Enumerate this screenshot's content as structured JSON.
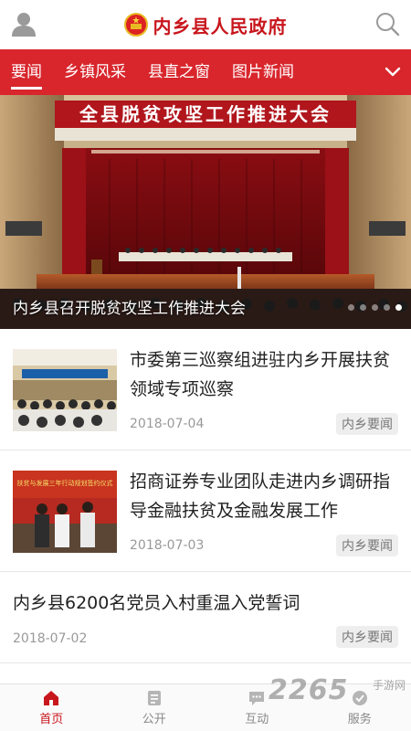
{
  "header": {
    "title": "内乡县人民政府",
    "avatar_icon": "user-icon",
    "emblem_icon": "national-emblem-icon",
    "search_icon": "search-icon"
  },
  "tabs": [
    {
      "label": "要闻",
      "active": true
    },
    {
      "label": "乡镇风采",
      "active": false
    },
    {
      "label": "县直之窗",
      "active": false
    },
    {
      "label": "图片新闻",
      "active": false
    }
  ],
  "hero": {
    "banner_text": "全县脱贫攻坚工作推进大会",
    "caption": "内乡县召开脱贫攻坚工作推进大会"
  },
  "news": [
    {
      "title": "市委第三巡察组进驻内乡开展扶贫领域专项巡察",
      "date": "2018-07-04",
      "tag": "内乡要闻"
    },
    {
      "title": "招商证券专业团队走进内乡调研指导金融扶贫及金融发展工作",
      "date": "2018-07-03",
      "tag": "内乡要闻",
      "thumb_banner": "扶贫与发展三年行动规划签约仪式"
    },
    {
      "title": "内乡县6200名党员入村重温入党誓词",
      "date": "2018-07-02",
      "tag": "内乡要闻"
    }
  ],
  "bottom_nav": [
    {
      "label": "首页",
      "icon": "home-icon",
      "active": true
    },
    {
      "label": "公开",
      "icon": "document-icon",
      "active": false
    },
    {
      "label": "互动",
      "icon": "chat-icon",
      "active": false
    },
    {
      "label": "服务",
      "icon": "service-icon",
      "active": false
    }
  ],
  "watermark": {
    "brand": "2265",
    "sub": "手游网"
  },
  "colors": {
    "accent": "#c8161d",
    "tab_bar": "#d8262c"
  }
}
